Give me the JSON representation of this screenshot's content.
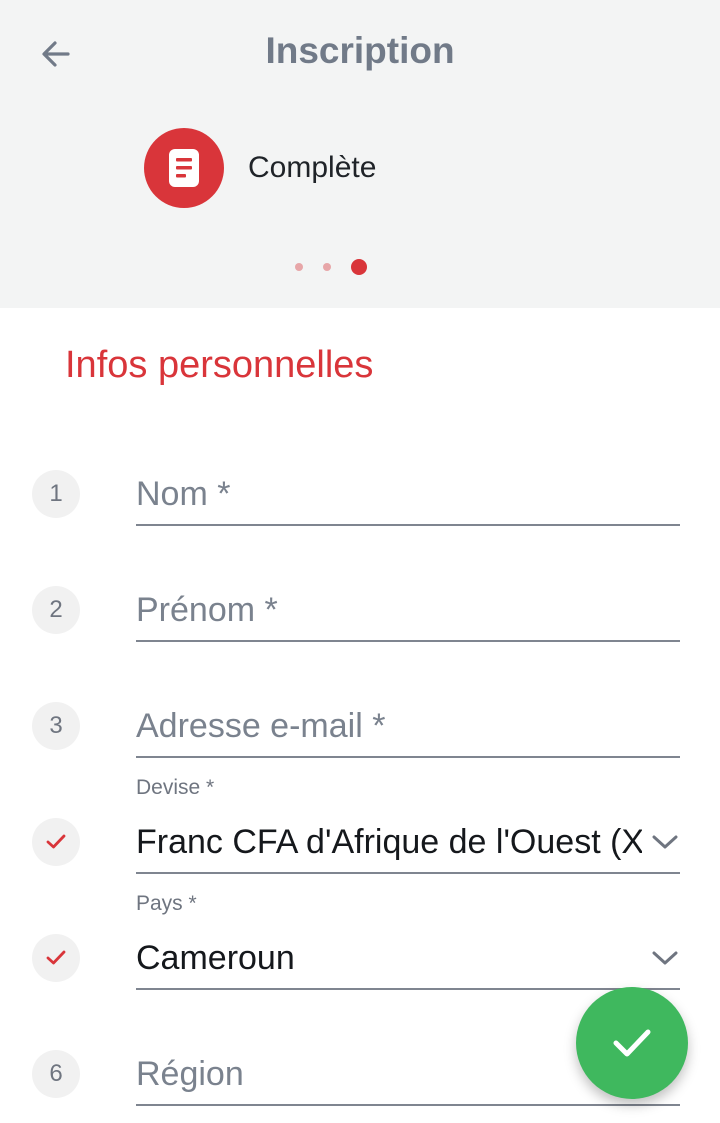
{
  "header": {
    "title": "Inscription",
    "step_label": "Complète",
    "step_icon": "document-icon",
    "accent": "#d9353a"
  },
  "section": {
    "title": "Infos personnelles"
  },
  "form": {
    "fields": [
      {
        "badge": "1",
        "placeholder": "Nom *"
      },
      {
        "badge": "2",
        "placeholder": "Prénom *"
      },
      {
        "badge": "3",
        "placeholder": "Adresse e-mail *"
      },
      {
        "label": "Devise *",
        "value": "Franc CFA d'Afrique de l'Ouest (X",
        "badge_icon": "check-icon"
      },
      {
        "label": "Pays *",
        "value": "Cameroun",
        "badge_icon": "check-icon"
      },
      {
        "badge": "6",
        "placeholder": "Région"
      }
    ]
  },
  "fab": {
    "icon": "check-icon",
    "color": "#3fb85e"
  }
}
